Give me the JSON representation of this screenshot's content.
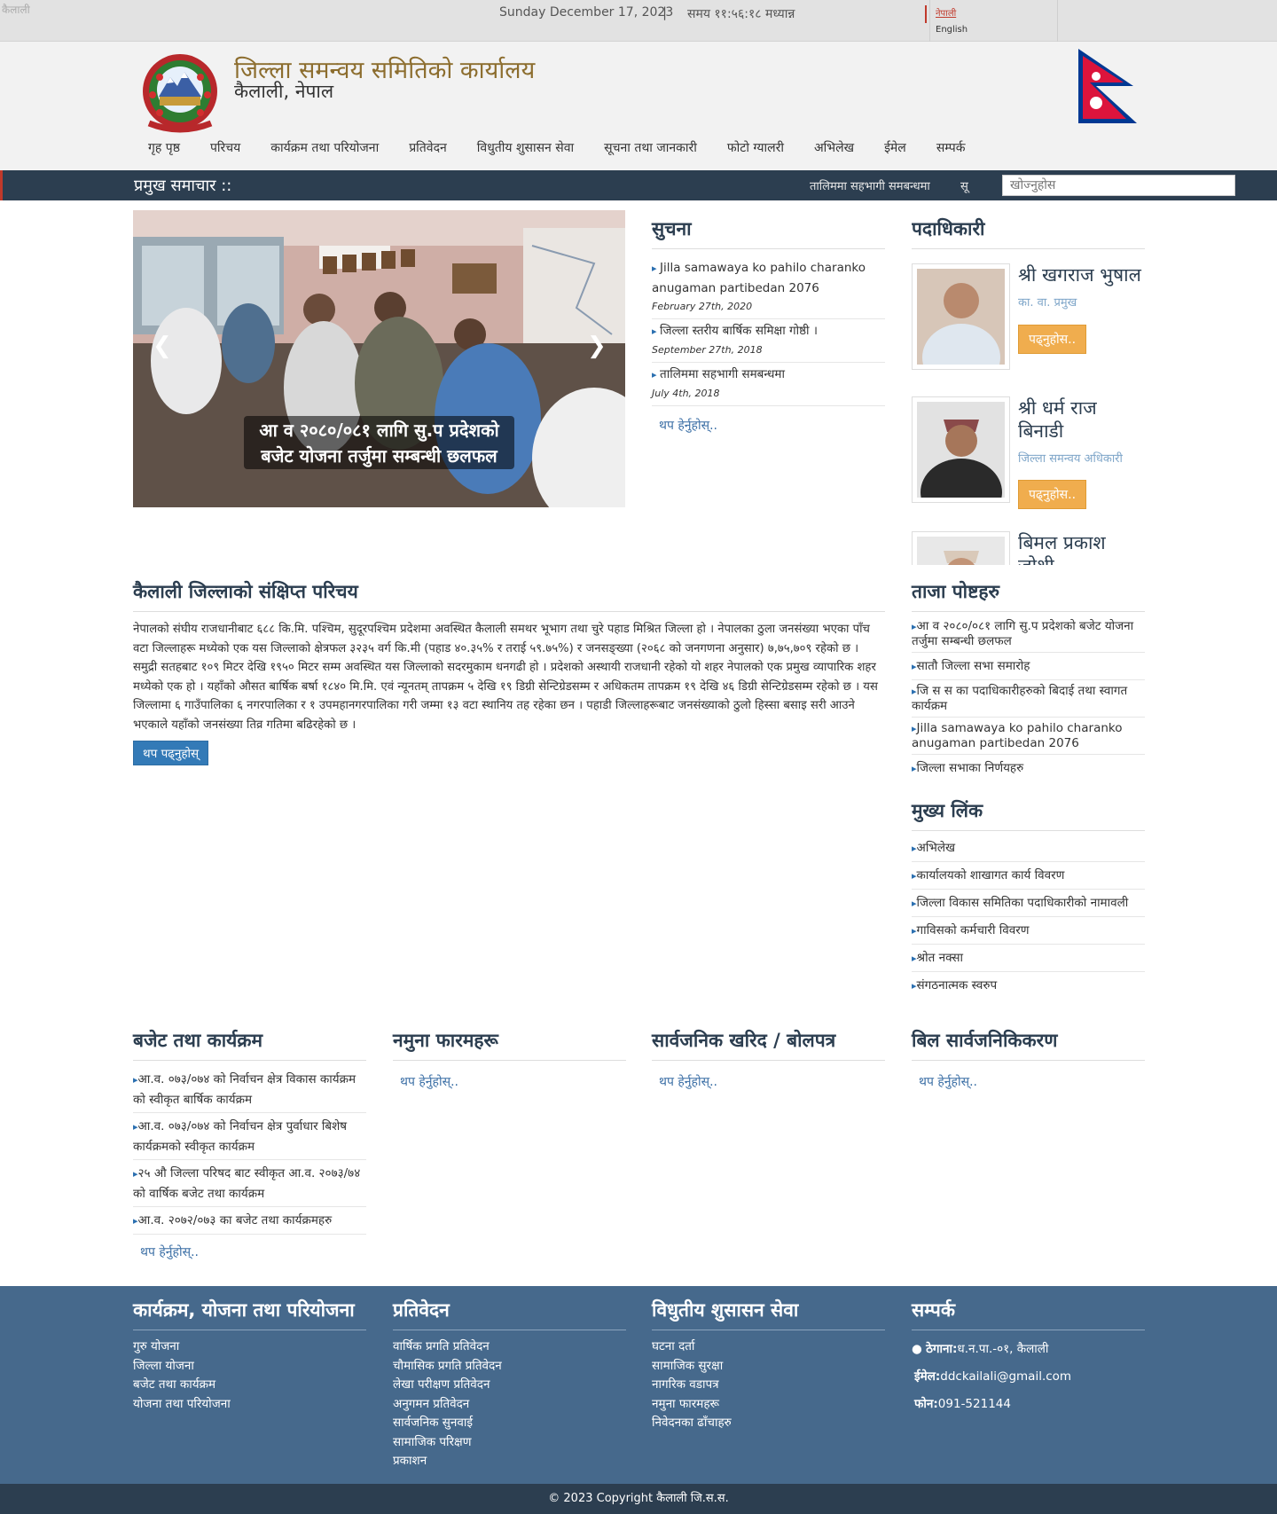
{
  "topbar": {
    "broken_logo_alt": "कैलाली",
    "date": "Sunday December 17, 2023",
    "separator": "|",
    "time": "समय ११:५६:१८ मध्यान्न",
    "lang_nepali": "नेपाली",
    "lang_english": "English"
  },
  "header": {
    "title": "जिल्ला समन्वय समितिको कार्यालय",
    "subtitle": "कैलाली, नेपाल",
    "emblem_text": "Government of Nepal emblem",
    "nav": [
      "गृह पृष्ठ",
      "परिचय",
      "कार्यक्रम तथा परियोजना",
      "प्रतिवेदन",
      "विधुतीय शुसासन सेवा",
      "सूचना तथा जानकारी",
      "फोटो ग्यालरी",
      "अभिलेख",
      "ईमेल",
      "सम्पर्क"
    ]
  },
  "newsbar": {
    "label": "प्रमुख समाचार ::",
    "ticker": "तालिममा सहभागी समबन्धमा",
    "ticker2": "सू",
    "search_placeholder": "खोज्नुहोस"
  },
  "slider": {
    "caption_line1": "आ व २०८०/०८१ लागि सु.प प्रदेशको",
    "caption_line2": "बजेट योजना तर्जुमा सम्बन्धी छलफल"
  },
  "notice": {
    "title": "सुचना",
    "items": [
      {
        "text": "Jilla samawaya ko pahilo charanko anugaman partibedan 2076",
        "date": "February 27th, 2020"
      },
      {
        "text": "जिल्ला स्तरीय बार्षिक समिक्षा गोष्ठी ।",
        "date": "September 27th, 2018"
      },
      {
        "text": "तालिममा सहभागी समबन्धमा",
        "date": "July 4th, 2018"
      }
    ],
    "more": "थप हेर्नुहोस्.."
  },
  "officials": {
    "title": "पदाधिकारी",
    "people": [
      {
        "name": "श्री खगराज भुषाल",
        "role": "का. वा. प्रमुख",
        "button": "पढ्नुहोस.."
      },
      {
        "name": "श्री धर्म राज बिनाडी",
        "role": "जिल्ला समन्वय अधिकारी",
        "button": "पढ्नुहोस.."
      },
      {
        "name": "बिमल प्रकाश जोशी",
        "role": "",
        "button": ""
      }
    ]
  },
  "intro": {
    "title": "कैलाली जिल्लाको संक्षिप्त परिचय",
    "body": "नेपालको संघीय राजधानीबाट ६८८ कि.मि. पश्चिम, सुदूरपश्चिम प्रदेशमा अवस्थित कैलाली समथर भूभाग तथा चुरे पहाड मिश्रित जिल्ला हो । नेपालका ठुला जनसंख्या भएका पाँच वटा जिल्लाहरू मध्येको एक यस जिल्लाको क्षेत्रफल ३२३५ वर्ग कि.मी (पहाड ४०.३५% र तराई ५९.७५%) र जनसङ्ख्या (२०६८ को जनगणना अनुसार) ७,७५,७०९ रहेको छ । समुद्री सतहबाट १०९ मिटर देखि १९५० मिटर सम्म अवस्थित यस जिल्लाको सदरमुकाम धनगढी हो । प्रदेशको अस्थायी राजधानी रहेको यो शहर नेपालको एक प्रमुख व्यापारिक शहर मध्येको एक हो । यहाँको औसत बार्षिक बर्षा १८४० मि.मि. एवं न्यूनतम् तापक्रम ५ देखि १९ डिग्री सेन्टिग्रेडसम्म र अधिकतम तापक्रम १९ देखि ४६ डिग्री सेन्टिग्रेडसम्म रहेको छ । यस जिल्लामा ६ गाउँपालिका ६ नगरपालिका र १ उपमहानगरपालिका गरी जम्मा १३ वटा स्थानिय तह रहेका छन । पहाडी जिल्लाहरूबाट जनसंख्याको ठुलो हिस्सा बसाइ सरी आउने भएकाले यहाँको जनसंख्या तिव्र गतिमा बढिरहेको छ ।",
    "button": "थप पढ्नुहोस्"
  },
  "latest": {
    "title": "ताजा पोष्टहरु",
    "items": [
      "आ व २०८०/०८१ लागि सु.प प्रदेशको बजेट योजना तर्जुमा सम्बन्धी छलफल",
      "सातौ जिल्ला सभा समारोह",
      "जि स स का पदाधिकारीहरुको बिदाई तथा स्वागत कार्यक्रम",
      "Jilla samawaya ko pahilo charanko anugaman partibedan 2076",
      "जिल्ला सभाका निर्णयहरु"
    ]
  },
  "links": {
    "title": "मुख्य लिंक",
    "items": [
      "अभिलेख",
      "कार्यालयको शाखागत कार्य विवरण",
      "जिल्ला विकास समितिका पदाधिकारीको नामावली",
      "गाविसको कर्मचारी विवरण",
      "श्रोत नक्सा",
      "संगठनात्मक स्वरुप"
    ]
  },
  "budget": {
    "title": "बजेट तथा कार्यक्रम",
    "items": [
      "आ.व. ०७३/०७४ को निर्वाचन क्षेत्र विकास कार्यक्रम को स्वीकृत बार्षिक कार्यक्रम",
      "आ.व. ०७३/०७४ को निर्वाचन क्षेत्र पुर्वाधार बिशेष कार्यक्रमको स्वीकृत कार्यक्रम",
      "२५ औ जिल्ला परिषद बाट स्वीकृत आ.व. २०७३/७४ को वार्षिक बजेट तथा कार्यक्रम",
      "आ.व. २०७२/०७३ का बजेट तथा कार्यक्रमहरु"
    ],
    "more": "थप हेर्नुहोस्.."
  },
  "forms": {
    "title": "नमुना फारमहरू",
    "more": "थप हेर्नुहोस्.."
  },
  "procurement": {
    "title": "सार्वजनिक खरिद / बोलपत्र",
    "more": "थप हेर्नुहोस्.."
  },
  "bills": {
    "title": "बिल सार्वजनिकिकरण",
    "more": "थप हेर्नुहोस्.."
  },
  "footer": {
    "col1": {
      "title": "कार्यक्रम, योजना तथा परियोजना",
      "items": [
        "गुरु योजना",
        "जिल्ला योजना",
        "बजेट तथा कार्यक्रम",
        "योजना तथा परियोजना"
      ]
    },
    "col2": {
      "title": "प्रतिवेदन",
      "items": [
        "वार्षिक प्रगति प्रतिवेदन",
        "चौमासिक प्रगति प्रतिवेदन",
        "लेखा परीक्षण प्रतिवेदन",
        "अनुगमन प्रतिवेदन",
        "सार्वजनिक सुनवाई",
        "सामाजिक परिक्षण",
        "प्रकाशन"
      ]
    },
    "col3": {
      "title": "विधुतीय शुसासन सेवा",
      "items": [
        "घटना दर्ता",
        "सामाजिक सुरक्षा",
        "नागरिक वडापत्र",
        "नमुना फारमहरू",
        "निवेदनका ढाँचाहरु"
      ]
    },
    "col4": {
      "title": "सम्पर्क",
      "address_label": "ठेगाना:",
      "address": "ध.न.पा.-०१, कैलाली",
      "email_label": "ईमेल:",
      "email": "ddckailali@gmail.com",
      "phone_label": "फोन:",
      "phone": "091-521144"
    },
    "copyright": "© 2023 Copyright कैलाली जि.स.स."
  },
  "colors": {
    "navy": "#2c3e50",
    "footer_blue": "#46698c",
    "accent_red": "#c0392b",
    "orange": "#f0ad4e",
    "link_blue": "#3a6ea5"
  }
}
